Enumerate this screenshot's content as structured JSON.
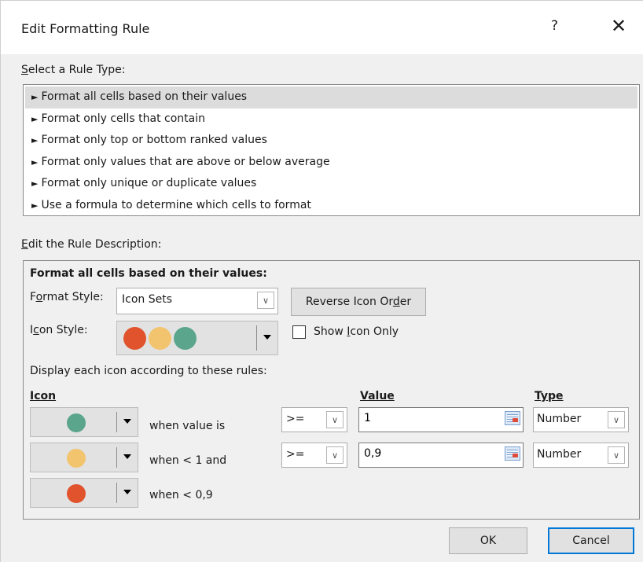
{
  "dialog": {
    "title": "Edit Formatting Rule",
    "help_label": "?",
    "close_label": "✕"
  },
  "rule_type": {
    "label": "Select a Rule Type:",
    "items": [
      {
        "label": "Format all cells based on their values",
        "selected": true
      },
      {
        "label": "Format only cells that contain",
        "selected": false
      },
      {
        "label": "Format only top or bottom ranked values",
        "selected": false
      },
      {
        "label": "Format only values that are above or below average",
        "selected": false
      },
      {
        "label": "Format only unique or duplicate values",
        "selected": false
      },
      {
        "label": "Use a formula to determine which cells to format",
        "selected": false
      }
    ]
  },
  "description": {
    "label": "Edit the Rule Description:",
    "heading": "Format all cells based on their values:",
    "format_style_label": "Format Style:",
    "format_style_value": "Icon Sets",
    "reverse_button": "Reverse Icon Order",
    "icon_style_label": "Icon Style:",
    "show_icon_only_label": "Show Icon Only",
    "show_icon_only_checked": false,
    "display_rules_label": "Display each icon according to these rules:",
    "col_icon": "Icon",
    "col_value": "Value",
    "col_type": "Type",
    "rows": [
      {
        "icon_color": "#5ba58c",
        "condition": "when value is",
        "operator": ">=",
        "value": "1",
        "type": "Number"
      },
      {
        "icon_color": "#f2c46d",
        "condition": "when < 1 and",
        "operator": ">=",
        "value": "0,9",
        "type": "Number"
      },
      {
        "icon_color": "#e0532d",
        "condition": "when < 0,9"
      }
    ]
  },
  "icon_set_colors": [
    "#e0532d",
    "#f2c46d",
    "#5ba58c"
  ],
  "buttons": {
    "ok": "OK",
    "cancel": "Cancel"
  },
  "icons": {
    "dropdown": "chevron-down-icon",
    "picker": "triangle-down-icon",
    "range": "range-select-icon"
  }
}
